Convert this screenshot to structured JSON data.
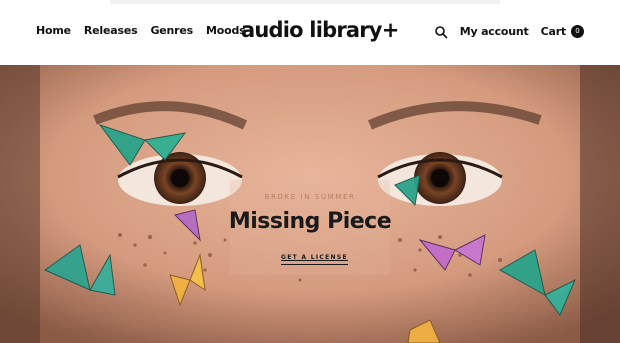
{
  "header": {
    "nav": [
      "Home",
      "Releases",
      "Genres",
      "Moods"
    ],
    "logo": "audio library+",
    "account_label": "My account",
    "cart_label": "Cart",
    "cart_count": "0"
  },
  "hero": {
    "eyebrow": "BROKE IN SUMMER",
    "title": "Missing Piece",
    "cta_label": "GET A LICENSE"
  },
  "icons": [
    "search-icon"
  ],
  "colors": {
    "text": "#111111",
    "skin": "#d9a48a",
    "eyebrow": "#b87d63"
  }
}
